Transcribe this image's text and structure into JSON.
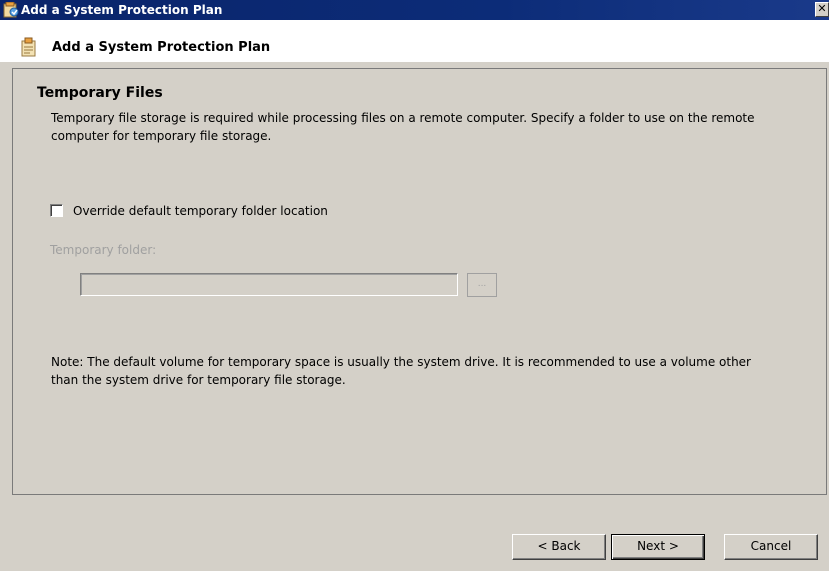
{
  "window": {
    "title": "Add a System Protection Plan",
    "close_glyph": "✕"
  },
  "header": {
    "title": "Add a System Protection Plan"
  },
  "panel": {
    "title": "Temporary Files",
    "description": "Temporary file storage is required while processing files on a remote computer. Specify a folder to use on the remote computer for temporary file storage.",
    "override_checkbox": {
      "label": "Override default temporary folder location",
      "checked": false
    },
    "folder_label": "Temporary folder:",
    "folder_value": "",
    "browse_label": "...",
    "note": "Note: The default volume for temporary space is usually the system drive. It is recommended to use a volume other than the system drive for temporary file storage."
  },
  "buttons": {
    "back": "< Back",
    "next": "Next >",
    "cancel": "Cancel"
  },
  "icons": {
    "app": "wizard-app-icon",
    "header": "wizard-page-icon"
  },
  "colors": {
    "titlebar": "#0a246a",
    "dialog_background": "#d4d0c8",
    "header_background": "#ffffff",
    "disabled_text": "#a0a0a0"
  }
}
